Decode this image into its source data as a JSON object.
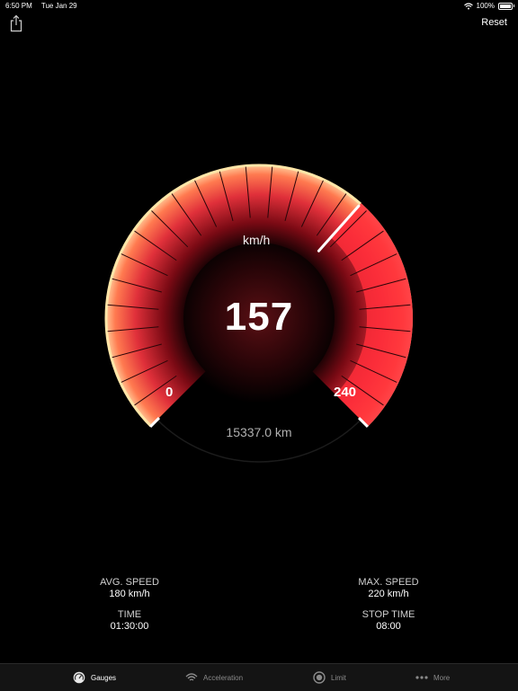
{
  "status_bar": {
    "time": "6:50 PM",
    "date": "Tue Jan 29",
    "battery": "100%"
  },
  "toolbar": {
    "reset_label": "Reset"
  },
  "gauge": {
    "unit": "km/h",
    "speed": "157",
    "speed_value": 157,
    "min_label": "0",
    "max_label": "240",
    "min_value": 0,
    "max_value": 240,
    "odometer": "15337.0 km",
    "colors": {
      "outer_warm": "#ff8a50",
      "highlight": "#ffe6a8",
      "red": "#ff2d3a",
      "needle": "#ffffff"
    }
  },
  "stats": {
    "avg_speed": {
      "title": "AVG. SPEED",
      "value": "180 km/h"
    },
    "time": {
      "title": "TIME",
      "value": "01:30:00"
    },
    "max_speed": {
      "title": "MAX. SPEED",
      "value": "220 km/h"
    },
    "stop_time": {
      "title": "STOP TIME",
      "value": "08:00"
    }
  },
  "tabbar": {
    "tabs": [
      {
        "label": "Gauges",
        "icon": "gauge-icon",
        "active": true
      },
      {
        "label": "Acceleration",
        "icon": "wifi-signal-icon",
        "active": false
      },
      {
        "label": "Limit",
        "icon": "speed-limit-icon",
        "active": false
      },
      {
        "label": "More",
        "icon": "more-dots-icon",
        "active": false
      }
    ]
  }
}
